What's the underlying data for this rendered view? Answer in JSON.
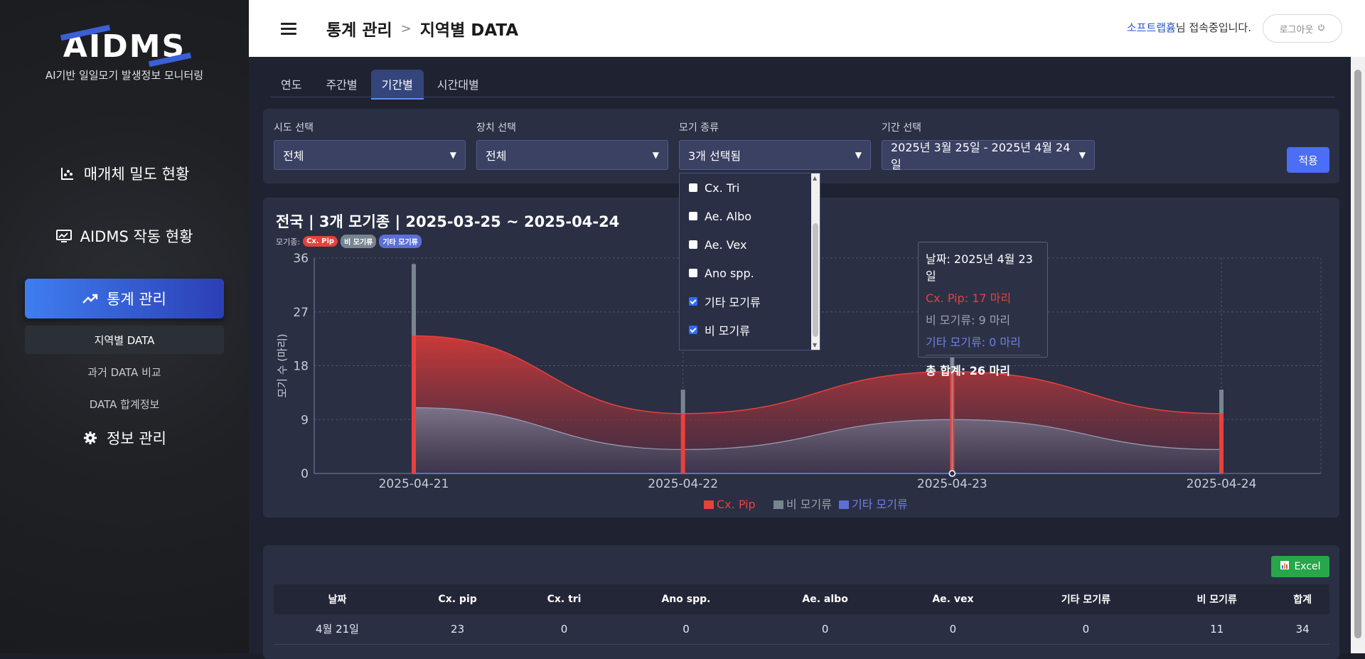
{
  "brand": {
    "logo": "AIDMS",
    "subtitle": "AI기반 일일모기 발생정보 모니터링"
  },
  "nav": {
    "items": [
      {
        "label": "매개체 밀도 현황",
        "icon": "scatter-chart-icon"
      },
      {
        "label": "AIDMS 작동 현황",
        "icon": "monitor-chart-icon"
      },
      {
        "label": "통계 관리",
        "icon": "trend-up-icon"
      },
      {
        "label": "정보 관리",
        "icon": "gear-icon"
      }
    ],
    "sub_items": [
      "지역별 DATA",
      "과거 DATA 비교",
      "DATA 합계정보"
    ]
  },
  "header": {
    "crumb1": "통계 관리",
    "crumb2": "지역별 DATA",
    "sep": ">",
    "user_name": "소프트랩흄",
    "user_suffix": "님 접속중입니다.",
    "logout": "로그아웃"
  },
  "tabs": [
    "연도",
    "주간별",
    "기간별",
    "시간대별"
  ],
  "filters": {
    "sido_label": "시도 선택",
    "sido_value": "전체",
    "device_label": "장치 선택",
    "device_value": "전체",
    "species_label": "모기 종류",
    "species_value": "3개 선택됨",
    "period_label": "기간 선택",
    "period_value": "2025년 3월 25일 - 2025년 4월 24일",
    "apply": "적용"
  },
  "dropdown_options": [
    {
      "label": "Cx. Tri",
      "checked": false
    },
    {
      "label": "Ae. Albo",
      "checked": false
    },
    {
      "label": "Ae. Vex",
      "checked": false
    },
    {
      "label": "Ano spp.",
      "checked": false
    },
    {
      "label": "기타 모기류",
      "checked": true
    },
    {
      "label": "비 모기류",
      "checked": true
    }
  ],
  "chart_header": {
    "title": "전국 | 3개 모기종 | 2025-03-25 ~ 2025-04-24",
    "species_label": "모기종:",
    "badges": [
      "Cx. Pip",
      "비 모기류",
      "기타 모기류"
    ]
  },
  "chart_data": {
    "type": "area",
    "x": [
      "2025-04-21",
      "2025-04-22",
      "2025-04-23",
      "2025-04-24"
    ],
    "ylabel": "모기 수 (마리)",
    "ylim": [
      0,
      36
    ],
    "yticks": [
      0,
      9,
      18,
      27,
      36
    ],
    "grid": true,
    "legend_position": "bottom",
    "series": [
      {
        "name": "Cx. Pip",
        "values": [
          23,
          10,
          17,
          10
        ],
        "color": "#e8413c"
      },
      {
        "name": "비 모기류",
        "values": [
          11,
          4,
          9,
          4
        ],
        "color": "#78858f"
      },
      {
        "name": "기타 모기류",
        "values": [
          0,
          0,
          0,
          0
        ],
        "color": "#5b6fd6"
      }
    ],
    "bars": {
      "total_values": [
        35,
        14,
        26,
        14
      ],
      "cx_values": [
        23,
        10,
        17,
        10
      ]
    }
  },
  "tooltip": {
    "date": "날짜: 2025년 4월 23일",
    "cx": "Cx. Pip: 17 마리",
    "non": "비 모기류: 9 마리",
    "other": "기타 모기류: 0 마리",
    "total": "총 합계: 26 마리"
  },
  "table": {
    "excel": "Excel",
    "headers": [
      "날짜",
      "Cx. pip",
      "Cx. tri",
      "Ano spp.",
      "Ae. albo",
      "Ae. vex",
      "기타 모기류",
      "비 모기류",
      "합계"
    ],
    "rows": [
      [
        "4월 21일",
        "23",
        "0",
        "0",
        "0",
        "0",
        "0",
        "11",
        "34"
      ]
    ]
  },
  "colors": {
    "accent": "#4b6ef5",
    "cx": "#e8413c",
    "non": "#78858f",
    "other": "#5b6fd6",
    "excel": "#27a64a"
  }
}
